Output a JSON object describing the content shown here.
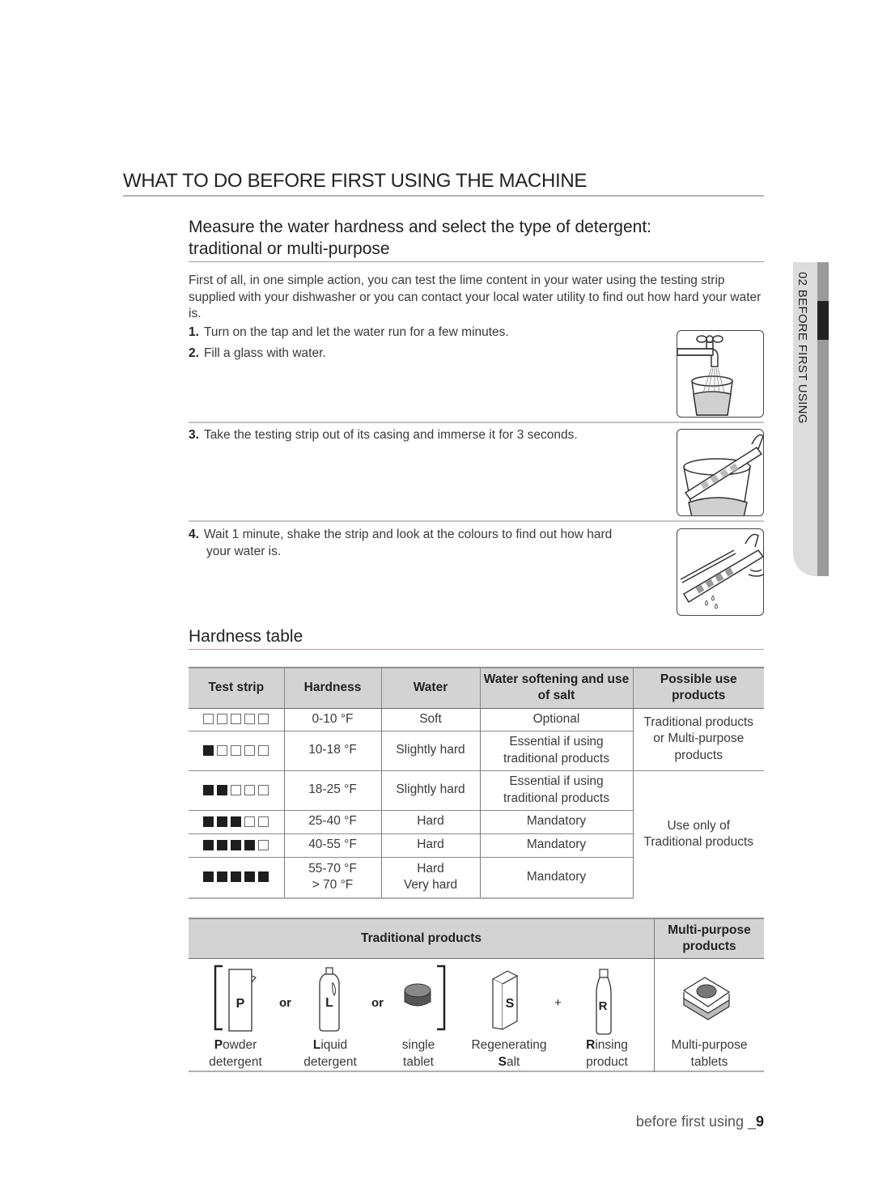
{
  "page": {
    "title": "WHAT TO DO BEFORE FIRST USING THE MACHINE",
    "section_title_line1": "Measure the water hardness and select the type of detergent:",
    "section_title_line2": "traditional or multi-purpose",
    "intro": "First of all, in one simple action, you can test the lime content in your water using the testing strip supplied with your dishwasher or you can contact your local water utility to find out how hard your water is."
  },
  "side_tab": {
    "label": "02 BEFORE FIRST USING"
  },
  "steps": [
    {
      "num": "1.",
      "text": "Turn on the tap and let the water run for a few minutes."
    },
    {
      "num": "2.",
      "text": "Fill a glass with water."
    },
    {
      "num": "3.",
      "text": "Take the testing strip out of its casing and immerse it for 3 seconds."
    },
    {
      "num": "4.",
      "text_line1": "Wait 1 minute, shake the strip and look at the colours to find out how hard",
      "text_line2": "your water is."
    }
  ],
  "illustrations": [
    "tap-filling-glass-icon",
    "strip-in-glass-icon",
    "shake-strip-icon"
  ],
  "hardness_table": {
    "title": "Hardness table",
    "headers": [
      "Test strip",
      "Hardness",
      "Water",
      "Water softening and use of salt",
      "Possible use products"
    ],
    "rows": [
      {
        "strip_filled": 0,
        "hardness": "0-10 °F",
        "water": "Soft",
        "softening": "Optional"
      },
      {
        "strip_filled": 1,
        "hardness": "10-18 °F",
        "water": "Slightly hard",
        "softening_line1": "Essential if using",
        "softening_line2": "traditional products"
      },
      {
        "strip_filled": 2,
        "hardness": "18-25 °F",
        "water": "Slightly hard",
        "softening_line1": "Essential if using",
        "softening_line2": "traditional products"
      },
      {
        "strip_filled": 3,
        "hardness": "25-40 °F",
        "water": "Hard",
        "softening": "Mandatory"
      },
      {
        "strip_filled": 4,
        "hardness": "40-55 °F",
        "water": "Hard",
        "softening": "Mandatory"
      },
      {
        "strip_filled": 5,
        "hardness_line1": "55-70 °F",
        "hardness_line2": "> 70 °F",
        "water_line1": "Hard",
        "water_line2": "Very hard",
        "softening": "Mandatory"
      }
    ],
    "products_group1_line1": "Traditional products",
    "products_group1_line2": "or Multi-purpose",
    "products_group1_line3": "products",
    "products_group2_line1": "Use only of",
    "products_group2_line2": "Traditional products"
  },
  "products_table": {
    "header_traditional": "Traditional products",
    "header_multi_line1": "Multi-purpose",
    "header_multi_line2": "products",
    "join_or": "or",
    "join_plus": "+",
    "items": [
      {
        "letter": "P",
        "label_rest": "owder",
        "label_line2": "detergent"
      },
      {
        "letter": "L",
        "label_rest": "iquid",
        "label_line2": "detergent"
      },
      {
        "label_line1": "single",
        "label_line2": "tablet"
      },
      {
        "letter": "S",
        "label_line1": "Regenerating",
        "label_rest": "alt"
      },
      {
        "letter": "R",
        "label_rest": "insing",
        "label_line2": "product"
      },
      {
        "label_line1": "Multi-purpose",
        "label_line2": "tablets"
      }
    ]
  },
  "footer": {
    "section": "before first using _",
    "page_number": "9"
  }
}
